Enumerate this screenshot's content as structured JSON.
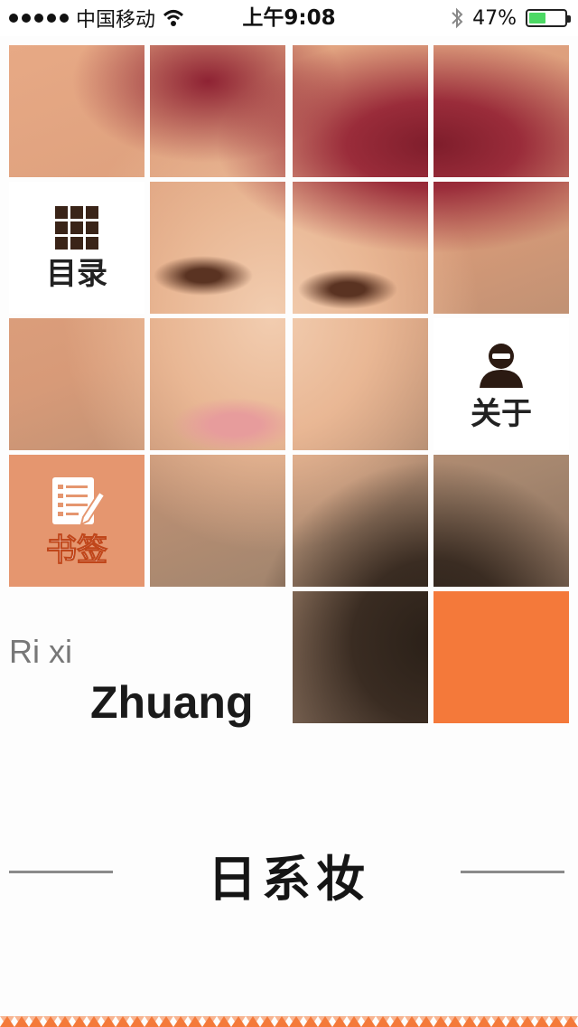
{
  "status_bar": {
    "carrier": "中国移动",
    "time": "上午9:08",
    "battery_percent": "47%",
    "battery_level": 0.47,
    "icons": [
      "signal-dots-icon",
      "wifi-icon",
      "bluetooth-icon",
      "battery-icon"
    ]
  },
  "menu": {
    "catalog_label": "目录",
    "about_label": "关于",
    "bookmark_label": "书签"
  },
  "brand": {
    "small": "Ri xi",
    "big": "Zhuang"
  },
  "page_title": "日系妆",
  "colors": {
    "accent_orange": "#f4793a",
    "peach": "#e5966f",
    "battery_green": "#4cd964"
  }
}
